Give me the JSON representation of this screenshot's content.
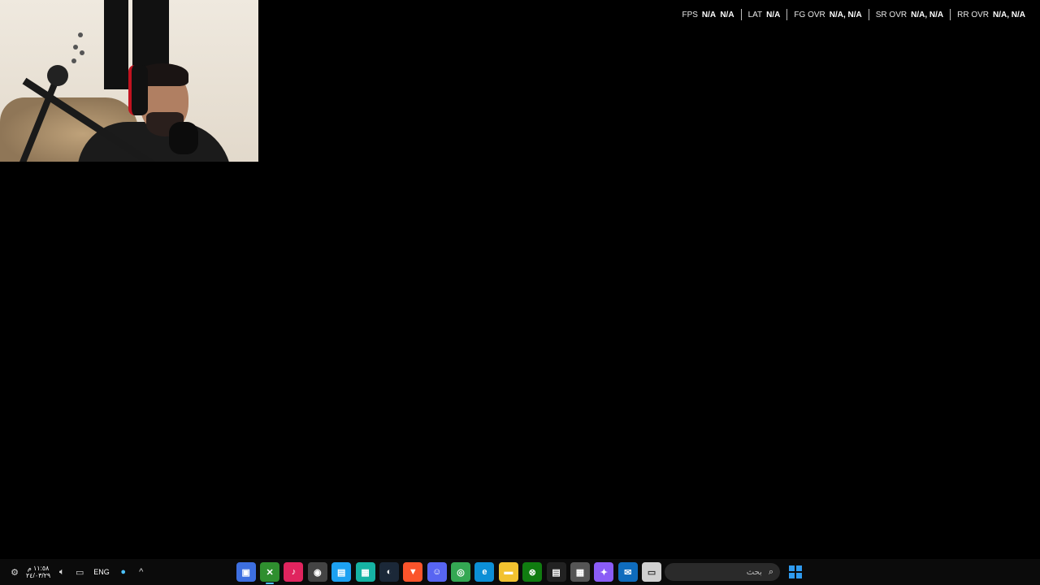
{
  "overlay": {
    "metrics": [
      {
        "label": "FPS",
        "value": "N/A  N/A"
      },
      {
        "label": "LAT",
        "value": "N/A"
      },
      {
        "label": "FG OVR",
        "value": "N/A, N/A"
      },
      {
        "label": "SR OVR",
        "value": "N/A, N/A"
      },
      {
        "label": "RR OVR",
        "value": "N/A, N/A"
      }
    ]
  },
  "taskbar": {
    "clock": {
      "time": "١١:٥٨ م",
      "date": "٢٤/٠٣/٢٩"
    },
    "language": "ENG",
    "search_placeholder": "بحث",
    "apps": [
      {
        "name": "app-blue-square",
        "color": "#3d6fe0",
        "glyph": "▣"
      },
      {
        "name": "xbox-app",
        "color": "#2f8f2f",
        "glyph": "✕",
        "active": true
      },
      {
        "name": "tiktok-app",
        "color": "#e0245e",
        "glyph": "♪"
      },
      {
        "name": "obs-app",
        "color": "#444",
        "glyph": "◉"
      },
      {
        "name": "app-cyan",
        "color": "#1da1f2",
        "glyph": "▤"
      },
      {
        "name": "app-teal",
        "color": "#16b3a3",
        "glyph": "▦"
      },
      {
        "name": "steam-app",
        "color": "#1b2838",
        "glyph": "◐"
      },
      {
        "name": "brave-app",
        "color": "#fb542b",
        "glyph": "▼"
      },
      {
        "name": "discord-app",
        "color": "#5865f2",
        "glyph": "☺"
      },
      {
        "name": "chrome-app",
        "color": "#34a853",
        "glyph": "◎"
      },
      {
        "name": "edge-app",
        "color": "#0c8fd6",
        "glyph": "e"
      },
      {
        "name": "file-explorer-app",
        "color": "#f2c230",
        "glyph": "▬"
      },
      {
        "name": "xbox-console-app",
        "color": "#107c10",
        "glyph": "⊗"
      },
      {
        "name": "ctrl-app",
        "color": "#222",
        "glyph": "▤"
      },
      {
        "name": "store-app",
        "color": "#555",
        "glyph": "▦"
      },
      {
        "name": "copilot-app",
        "color": "#8a5cf6",
        "glyph": "✦"
      },
      {
        "name": "mail-app",
        "color": "#0f6cbd",
        "glyph": "✉"
      },
      {
        "name": "app-window",
        "color": "#d0d0d0",
        "glyph": "▭"
      }
    ]
  }
}
